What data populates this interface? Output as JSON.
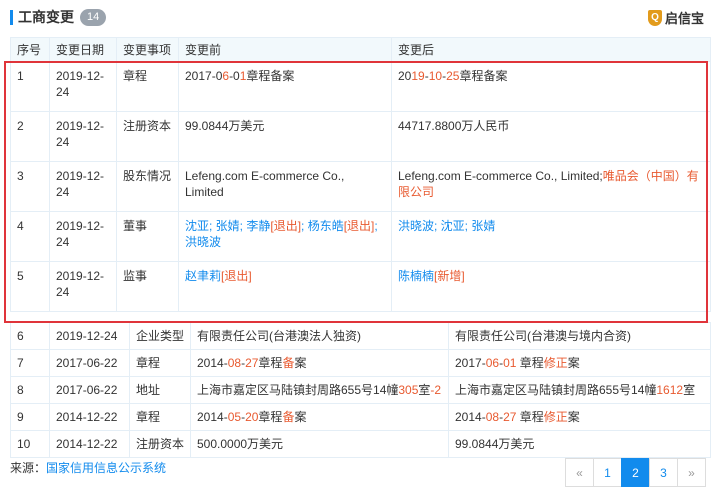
{
  "header": {
    "title": "工商变更",
    "count": "14"
  },
  "brand": {
    "name": "启信宝",
    "logo_char": "Q"
  },
  "columns": [
    "序号",
    "变更日期",
    "变更事项",
    "变更前",
    "变更后"
  ],
  "rows": [
    {
      "no": "1",
      "date": "2019-12-24",
      "item": "章程",
      "before": [
        {
          "t": "2017-0"
        },
        {
          "t": "6",
          "c": "red"
        },
        {
          "t": "-0"
        },
        {
          "t": "1",
          "c": "red"
        },
        {
          "t": "章程备案"
        }
      ],
      "after": [
        {
          "t": "20"
        },
        {
          "t": "19",
          "c": "red"
        },
        {
          "t": "-"
        },
        {
          "t": "10",
          "c": "red"
        },
        {
          "t": "-"
        },
        {
          "t": "25",
          "c": "red"
        },
        {
          "t": "章程备案"
        }
      ]
    },
    {
      "no": "2",
      "date": "2019-12-24",
      "item": "注册资本",
      "before": [
        {
          "t": "99.0844万美元"
        }
      ],
      "after": [
        {
          "t": "44717.8800万人民币"
        }
      ]
    },
    {
      "no": "3",
      "date": "2019-12-24",
      "item": "股东情况",
      "before": [
        {
          "t": "Lefeng.com E-commerce Co., Limited"
        }
      ],
      "after": [
        {
          "t": "Lefeng.com E-commerce Co., Limited;"
        },
        {
          "t": "唯品会（中国）有限公司",
          "c": "red"
        }
      ]
    },
    {
      "no": "4",
      "date": "2019-12-24",
      "item": "董事",
      "before": [
        {
          "t": "沈亚; 张婧; ",
          "c": "blue"
        },
        {
          "t": "李静",
          "c": "blue"
        },
        {
          "t": "[退出]",
          "c": "red"
        },
        {
          "t": "; ",
          "c": "blue"
        },
        {
          "t": "杨东皓",
          "c": "blue"
        },
        {
          "t": "[退出]",
          "c": "red"
        },
        {
          "t": "; 洪晓波",
          "c": "blue"
        }
      ],
      "after": [
        {
          "t": "洪晓波; 沈亚; 张婧",
          "c": "blue"
        }
      ]
    },
    {
      "no": "5",
      "date": "2019-12-24",
      "item": "监事",
      "before": [
        {
          "t": "赵聿莉",
          "c": "blue"
        },
        {
          "t": "[退出]",
          "c": "red"
        }
      ],
      "after": [
        {
          "t": "陈楠楠",
          "c": "blue"
        },
        {
          "t": "[新增]",
          "c": "red"
        }
      ]
    }
  ],
  "rows2": [
    {
      "no": "6",
      "date": "2019-12-24",
      "item": "企业类型",
      "before": [
        {
          "t": "有限责任公司(台港澳法人独资)"
        }
      ],
      "after": [
        {
          "t": "有限责任公司(台港澳与境内合资)"
        }
      ]
    },
    {
      "no": "7",
      "date": "2017-06-22",
      "item": "章程",
      "before": [
        {
          "t": "2014-"
        },
        {
          "t": "08",
          "c": "red"
        },
        {
          "t": "-"
        },
        {
          "t": "27",
          "c": "red"
        },
        {
          "t": "章程"
        },
        {
          "t": "备",
          "c": "red"
        },
        {
          "t": "案"
        }
      ],
      "after": [
        {
          "t": "2017-"
        },
        {
          "t": "06",
          "c": "red"
        },
        {
          "t": "-"
        },
        {
          "t": "01",
          "c": "red"
        },
        {
          "t": " 章程"
        },
        {
          "t": "修正",
          "c": "red"
        },
        {
          "t": "案"
        }
      ]
    },
    {
      "no": "8",
      "date": "2017-06-22",
      "item": "地址",
      "before": [
        {
          "t": "上海市嘉定区马陆镇封周路655号14幢"
        },
        {
          "t": "305",
          "c": "red"
        },
        {
          "t": "室"
        },
        {
          "t": "-2",
          "c": "red"
        }
      ],
      "after": [
        {
          "t": "上海市嘉定区马陆镇封周路655号14幢"
        },
        {
          "t": "1612",
          "c": "red"
        },
        {
          "t": "室"
        }
      ]
    },
    {
      "no": "9",
      "date": "2014-12-22",
      "item": "章程",
      "before": [
        {
          "t": "2014-"
        },
        {
          "t": "05",
          "c": "red"
        },
        {
          "t": "-"
        },
        {
          "t": "20",
          "c": "red"
        },
        {
          "t": "章程"
        },
        {
          "t": "备",
          "c": "red"
        },
        {
          "t": "案"
        }
      ],
      "after": [
        {
          "t": "2014-"
        },
        {
          "t": "08",
          "c": "red"
        },
        {
          "t": "-"
        },
        {
          "t": "27",
          "c": "red"
        },
        {
          "t": " 章程"
        },
        {
          "t": "修正",
          "c": "red"
        },
        {
          "t": "案"
        }
      ]
    },
    {
      "no": "10",
      "date": "2014-12-22",
      "item": "注册资本",
      "before": [
        {
          "t": "500.0000万美元"
        }
      ],
      "after": [
        {
          "t": "99.0844万美元"
        }
      ]
    }
  ],
  "source": {
    "label": "来源：",
    "link": "国家信用信息公示系统"
  },
  "pagination": {
    "prev": "«",
    "pages": [
      "1",
      "2",
      "3"
    ],
    "active": "2",
    "next": "»"
  },
  "colors": {
    "accent": "#128bed",
    "highlight": "#e85a30",
    "box": "#e0343a",
    "header_bg": "#f2f9fc"
  }
}
